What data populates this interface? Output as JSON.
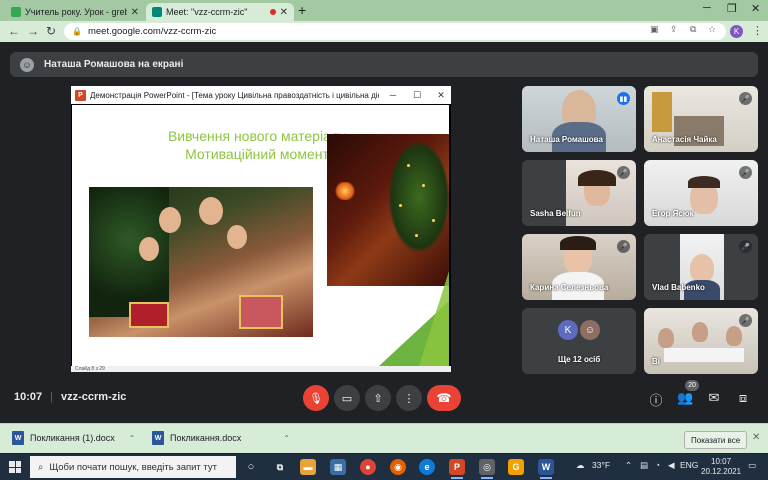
{
  "browser": {
    "tabs": [
      {
        "title": "Учитель року. Урок - grebench",
        "favicon_color": "#34a853"
      },
      {
        "title": "Meet: \"vzz-ccrm-zic\"",
        "favicon_color": "#00897b",
        "recording": true
      }
    ],
    "url": "meet.google.com/vzz-ccrm-zic",
    "profile_initial": "K",
    "profile_color": "#7e57c2"
  },
  "banner": {
    "text": "Наташа Ромашова на екрані"
  },
  "presentation": {
    "window_title": "Демонстрація PowerPoint - [Тема уроку Цивільна правоздатність і цивільна діє...",
    "app_icon_label": "P",
    "slide_title_line1": "Вивчення нового матеріалу",
    "slide_title_line2": "Мотиваційний момент",
    "status_text": "Слайд 8 з 29",
    "accent_color": "#8cc63e"
  },
  "participants": [
    {
      "name": "Наташа Ромашова",
      "speaking": true
    },
    {
      "name": "Анастасія Чайка",
      "speaking": false
    },
    {
      "name": "Sasha Belfun",
      "speaking": false
    },
    {
      "name": "Егор Ясюк",
      "speaking": false
    },
    {
      "name": "Карина Селезньова",
      "speaking": false
    },
    {
      "name": "Vlad Babenko",
      "speaking": false
    },
    {
      "name": "Ще 12 осіб",
      "avatar_initial": "K"
    },
    {
      "name": "Ві",
      "speaking": false
    }
  ],
  "meetbar": {
    "time": "10:07",
    "meeting_code": "vzz-ccrm-zic",
    "participant_count": "20"
  },
  "downloads": {
    "items": [
      {
        "name": "Покликання (1).docx"
      },
      {
        "name": "Покликання.docx"
      }
    ],
    "show_all": "Показати все"
  },
  "taskbar": {
    "search_placeholder": "Щоби почати пошук, введіть запит тут",
    "weather": "33°F",
    "language": "ENG",
    "time": "10:07",
    "date": "20.12.2021"
  }
}
